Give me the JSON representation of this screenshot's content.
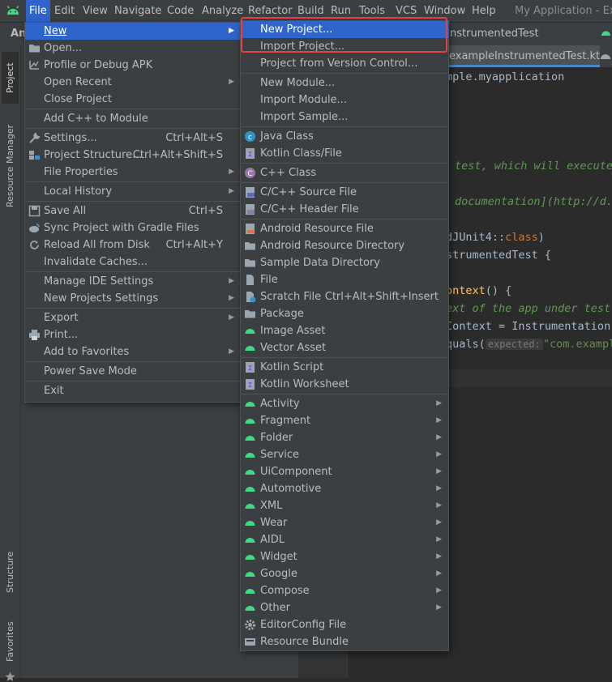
{
  "menubar": {
    "items": [
      "File",
      "Edit",
      "View",
      "Navigate",
      "Code",
      "Analyze",
      "Refactor",
      "Build",
      "Run",
      "Tools",
      "VCS",
      "Window",
      "Help"
    ],
    "app_title": "My Application - Exa"
  },
  "toolbar": {
    "project_short": "An"
  },
  "editor": {
    "breadcrumb": "nstrumentedTest",
    "tab_label": "exampleInstrumentedTest.kt",
    "lines": {
      "l1": "mple.myapplication",
      "l2": "test, which will execute",
      "l3": "documentation](http://d.",
      "l4a": "dJUnit4::",
      "l4b": "class",
      "l4c": ")",
      "l5": "strumentedTest {",
      "l6a": "ontext",
      "l6b": "() {",
      "l7": "ext of the app under test",
      "l8": "Context = Instrumentation",
      "l9a": "quals(",
      "l9hint": "expected:",
      "l9str": "\"com.exampl"
    }
  },
  "left_strip": {
    "tabs": [
      "Project",
      "Resource Manager",
      "Structure",
      "Favorites"
    ]
  },
  "file_menu": {
    "items": [
      {
        "label": "New",
        "submenu": true,
        "highlight": true
      },
      {
        "label": "Open..."
      },
      {
        "label": "Profile or Debug APK"
      },
      {
        "label": "Open Recent",
        "submenu": true
      },
      {
        "label": "Close Project"
      },
      {
        "label": "Add C++ to Module"
      },
      {
        "label": "Settings...",
        "shortcut": "Ctrl+Alt+S"
      },
      {
        "label": "Project Structure...",
        "shortcut": "Ctrl+Alt+Shift+S"
      },
      {
        "label": "File Properties",
        "submenu": true
      },
      {
        "label": "Local History",
        "submenu": true
      },
      {
        "label": "Save All",
        "shortcut": "Ctrl+S"
      },
      {
        "label": "Sync Project with Gradle Files"
      },
      {
        "label": "Reload All from Disk",
        "shortcut": "Ctrl+Alt+Y"
      },
      {
        "label": "Invalidate Caches..."
      },
      {
        "label": "Manage IDE Settings",
        "submenu": true
      },
      {
        "label": "New Projects Settings",
        "submenu": true
      },
      {
        "label": "Export",
        "submenu": true
      },
      {
        "label": "Print..."
      },
      {
        "label": "Add to Favorites",
        "submenu": true
      },
      {
        "label": "Power Save Mode"
      },
      {
        "label": "Exit"
      }
    ]
  },
  "new_menu": {
    "items": [
      {
        "label": "New Project...",
        "highlight": true
      },
      {
        "label": "Import Project..."
      },
      {
        "label": "Project from Version Control..."
      },
      {
        "label": "New Module..."
      },
      {
        "label": "Import Module..."
      },
      {
        "label": "Import Sample..."
      },
      {
        "label": "Java Class"
      },
      {
        "label": "Kotlin Class/File"
      },
      {
        "label": "C++ Class"
      },
      {
        "label": "C/C++ Source File"
      },
      {
        "label": "C/C++ Header File"
      },
      {
        "label": "Android Resource File"
      },
      {
        "label": "Android Resource Directory"
      },
      {
        "label": "Sample Data Directory"
      },
      {
        "label": "File"
      },
      {
        "label": "Scratch File",
        "shortcut": "Ctrl+Alt+Shift+Insert"
      },
      {
        "label": "Package"
      },
      {
        "label": "Image Asset"
      },
      {
        "label": "Vector Asset"
      },
      {
        "label": "Kotlin Script"
      },
      {
        "label": "Kotlin Worksheet"
      },
      {
        "label": "Activity",
        "submenu": true
      },
      {
        "label": "Fragment",
        "submenu": true
      },
      {
        "label": "Folder",
        "submenu": true
      },
      {
        "label": "Service",
        "submenu": true
      },
      {
        "label": "UiComponent",
        "submenu": true
      },
      {
        "label": "Automotive",
        "submenu": true
      },
      {
        "label": "XML",
        "submenu": true
      },
      {
        "label": "Wear",
        "submenu": true
      },
      {
        "label": "AIDL",
        "submenu": true
      },
      {
        "label": "Widget",
        "submenu": true
      },
      {
        "label": "Google",
        "submenu": true
      },
      {
        "label": "Compose",
        "submenu": true
      },
      {
        "label": "Other",
        "submenu": true
      },
      {
        "label": "EditorConfig File"
      },
      {
        "label": "Resource Bundle"
      }
    ]
  },
  "colors": {
    "menu_bg": "#3c3f41",
    "highlight": "#2f65ca",
    "annotation_box": "#e0414a",
    "android_green": "#3ddc84"
  }
}
